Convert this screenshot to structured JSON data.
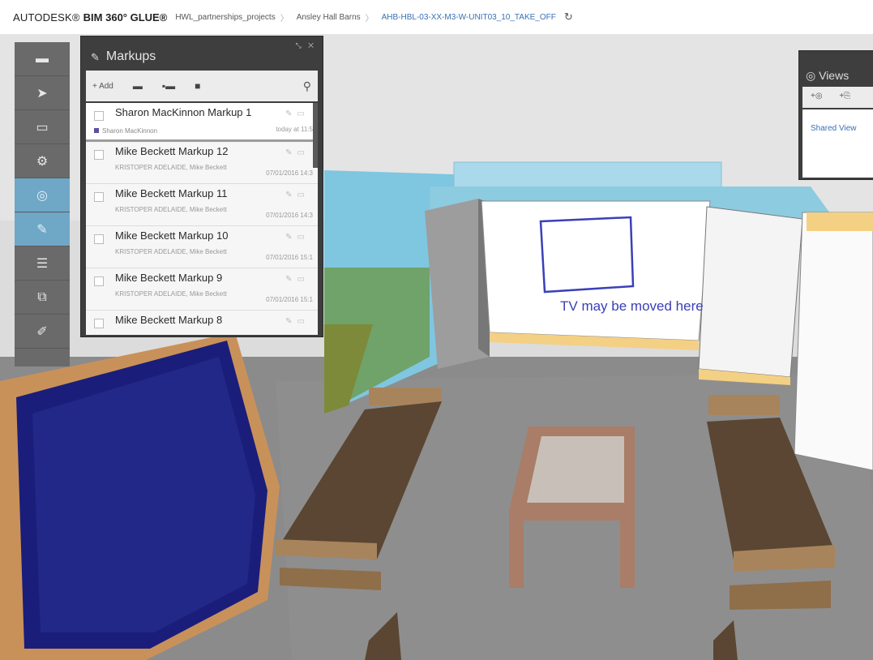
{
  "header": {
    "brand_autodesk": "AUTODESK®",
    "brand_product": "BIM 360° GLUE®",
    "breadcrumbs": [
      "HWL_partnerships_projects",
      "Ansley Hall Barns",
      "AHB-HBL-03-XX-M3-W-UNIT03_10_TAKE_OFF"
    ],
    "separator": "〉",
    "refresh_icon": "↻"
  },
  "toolbar": {
    "tools": [
      {
        "name": "home",
        "icon": "▬",
        "active": false
      },
      {
        "name": "select",
        "icon": "➤",
        "active": false
      },
      {
        "name": "measure",
        "icon": "▭",
        "active": false
      },
      {
        "name": "clash",
        "icon": "⚙",
        "active": false
      },
      {
        "name": "views",
        "icon": "◎",
        "active": true
      },
      {
        "name": "markup",
        "icon": "✎",
        "active": true
      },
      {
        "name": "list",
        "icon": "☰",
        "active": false
      },
      {
        "name": "layers",
        "icon": "⧉",
        "active": false
      },
      {
        "name": "attach",
        "icon": "✐",
        "active": false
      }
    ]
  },
  "markups_panel": {
    "title": "Markups",
    "toolbar": {
      "add": "+ Add",
      "search_icon": "⚲"
    },
    "items": [
      {
        "title": "Sharon MacKinnon Markup 1",
        "author": "Sharon MacKinnon",
        "date": "today at 11:5"
      },
      {
        "title": "Mike Beckett Markup 12",
        "author": "KRISTOPER ADELAIDE, Mike Beckett",
        "date": "07/01/2016 14:3"
      },
      {
        "title": "Mike Beckett Markup 11",
        "author": "KRISTOPER ADELAIDE, Mike Beckett",
        "date": "07/01/2016 14:3"
      },
      {
        "title": "Mike Beckett Markup 10",
        "author": "KRISTOPER ADELAIDE, Mike Beckett",
        "date": "07/01/2016 15:1"
      },
      {
        "title": "Mike Beckett Markup 9",
        "author": "KRISTOPER ADELAIDE, Mike Beckett",
        "date": "07/01/2016 15:1"
      },
      {
        "title": "Mike Beckett Markup 8",
        "author": "",
        "date": ""
      }
    ]
  },
  "views_panel": {
    "title": "Views",
    "shared_views": "Shared View"
  },
  "annotation": {
    "text": "TV may be moved here"
  },
  "colors": {
    "panel_bg": "#3e3e3e",
    "toolbar_bg": "#6a6a6a",
    "active_tool": "#6fa7c7",
    "markup_blue": "#3a40b8",
    "link_blue": "#3a6fb4"
  }
}
